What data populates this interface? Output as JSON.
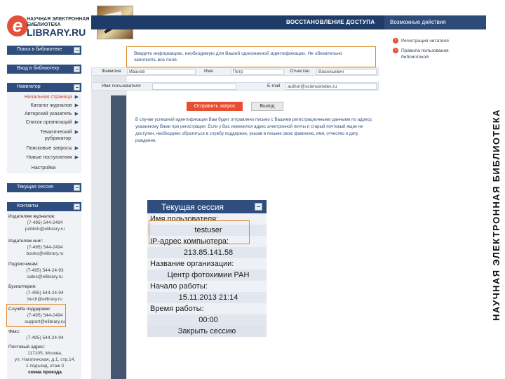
{
  "logo": {
    "letter": "e",
    "line1": "НАУЧНАЯ ЭЛЕКТРОННАЯ",
    "line2": "БИБЛИОТЕКА",
    "brand": "LIBRARY.RU"
  },
  "header": {
    "title": "ВОССТАНОВЛЕНИЕ ДОСТУПА",
    "right": "Возможные действия"
  },
  "vertical_banner": "НАУЧНАЯ ЭЛЕКТРОННАЯ БИБЛИОТЕКА",
  "sidebar": {
    "search_label": "Поиск в библиотеке",
    "login_label": "Вход в библиотеку",
    "nav_label": "Навигатор",
    "nav_items": [
      {
        "label": "Начальная страница",
        "active": true
      },
      {
        "label": "Каталог журналов"
      },
      {
        "label": "Авторский указатель"
      },
      {
        "label": "Список организаций"
      },
      {
        "label": "Тематический"
      },
      {
        "label": "рубрикатор"
      },
      {
        "label": "Поисковые запросы"
      },
      {
        "label": "Новые поступления"
      },
      {
        "label": "Настройка"
      }
    ],
    "session_label": "Текущая сессия",
    "contacts_label": "Контакты",
    "contacts": [
      {
        "label": "Издателям журналов:",
        "phone": "(7-495) 544-2494",
        "email": "publish@elibrary.ru"
      },
      {
        "label": "Издателям книг:",
        "phone": "(7-495) 544-2494",
        "email": "books@elibrary.ru"
      },
      {
        "label": "Подписчикам:",
        "phone": "(7-495) 544-24-93",
        "email": "sales@elibrary.ru"
      },
      {
        "label": "Бухгалтерия:",
        "phone": "(7-495) 544-24-94",
        "email": "buch@elibrary.ru"
      },
      {
        "label": "Служба поддержки:",
        "phone": "(7-495) 544-2494",
        "email": "support@elibrary.ru"
      },
      {
        "label": "Факс:",
        "phone": "(7-495) 544-24-94",
        "email": ""
      }
    ],
    "address_label": "Почтовый адрес:",
    "address_lines": [
      "117105, Москва,",
      "ул. Нагатинская, д.1, стр.14,",
      "1 подъезд, этаж 3"
    ],
    "map_label": "схема проезда"
  },
  "info_box": {
    "line1": "Введите информацию, необходимую для Вашей однозначной идентификации. Не обязательно",
    "line2": "заполнять все поля."
  },
  "form": {
    "row1": {
      "surname_label": "Фамилия",
      "name_label": "Имя",
      "name_value": "Петр",
      "surname_value": "Иванов",
      "patronymic_label": "Отчество",
      "patronymic_value": "Васильевич"
    },
    "row2": {
      "user_label": "Имя пользователя",
      "email_label": "E-mail",
      "email_value": "author@scienceindex.ru"
    }
  },
  "buttons": {
    "submit": "Отправить запрос",
    "exit": "Выход"
  },
  "note": "В случае успешной идентификации Вам будет отправлено письмо с Вашими регистрационными данными по адресу, указанному Вами при регистрации. Если у Вас изменился адрес электронной почты и старый почтовый ящик не доступен, необходимо обратиться в службу поддержки, указав в письме свою фамилию, имя, отчество и дату рождения.",
  "side_actions": [
    "Регистрация читателя",
    "Правила пользования библиотекой"
  ],
  "session": {
    "title": "Текущая сессия",
    "user_label": "Имя пользователя:",
    "user_value": "testuser",
    "ip_label": "IP-адрес компьютера:",
    "ip_value": "213.85.141.58",
    "org_label": "Название организации:",
    "org_value": "Центр фотохимии РАН",
    "start_label": "Начало работы:",
    "start_value": "15.11.2013 21:14",
    "time_label": "Время работы:",
    "time_value": "00:00",
    "close_label": "Закрыть сессию"
  }
}
